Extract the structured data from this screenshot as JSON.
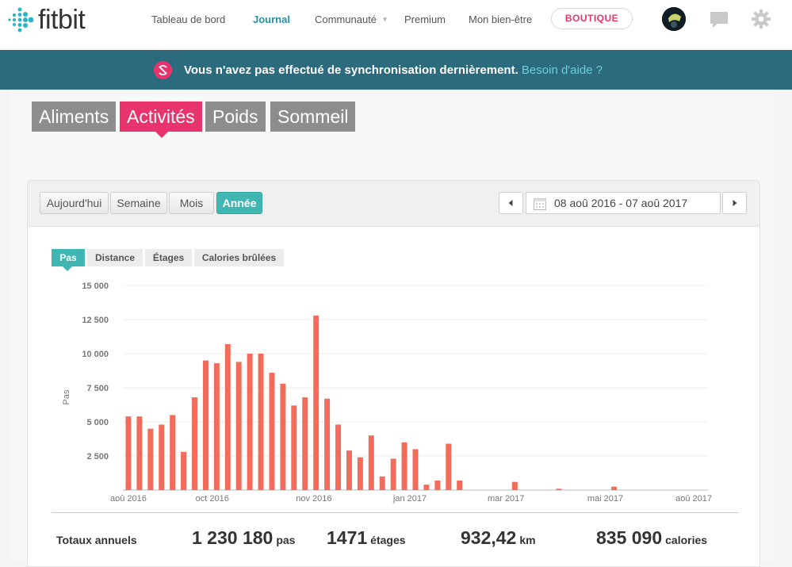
{
  "brand": {
    "name": "fitbit",
    "accent": "#e8336d",
    "teal": "#3fb6b2",
    "banner_bg": "#2b6b7d"
  },
  "nav": {
    "items": [
      {
        "label": "Tableau de bord"
      },
      {
        "label": "Journal"
      },
      {
        "label": "Communauté"
      },
      {
        "label": "Premium"
      },
      {
        "label": "Mon bien-être"
      }
    ],
    "boutique": "BOUTIQUE",
    "icons": [
      "avatar",
      "chat-icon",
      "gear-icon"
    ]
  },
  "banner": {
    "message": "Vous n'avez pas effectué de synchronisation dernièrement.",
    "help": "Besoin d'aide ?"
  },
  "category_tabs": [
    "Aliments",
    "Activités",
    "Poids",
    "Sommeil"
  ],
  "range": {
    "buttons": [
      "Aujourd'hui",
      "Semaine",
      "Mois",
      "Année"
    ],
    "active": "Année",
    "date_range": "08 aoû 2016 - 07 aoû 2017"
  },
  "metric_tabs": [
    "Pas",
    "Distance",
    "Étages",
    "Calories brûlées"
  ],
  "chart_data": {
    "type": "bar",
    "ylabel": "Pas",
    "ylim": [
      0,
      15000
    ],
    "yticks": [
      "2 500",
      "5 000",
      "7 500",
      "10 000",
      "12 500",
      "15 000"
    ],
    "ytick_values": [
      2500,
      5000,
      7500,
      10000,
      12500,
      15000
    ],
    "xtick_labels": [
      "aoû 2016",
      "oct 2016",
      "nov 2016",
      "jan 2017",
      "mar 2017",
      "mai 2017",
      "aoû 2017"
    ],
    "xtick_weeks": [
      0,
      7.6,
      16.8,
      25.5,
      34.2,
      43.2,
      52
    ],
    "bar_color": "#f26b5b",
    "weeks": 53,
    "values": [
      5400,
      5400,
      4500,
      4800,
      5500,
      2800,
      6800,
      9500,
      9300,
      10700,
      9400,
      10000,
      10000,
      8600,
      7800,
      6200,
      6800,
      12800,
      6700,
      4800,
      2900,
      2400,
      4000,
      1000,
      2300,
      3500,
      3000,
      400,
      700,
      3400,
      700,
      0,
      0,
      0,
      0,
      600,
      0,
      0,
      0,
      100,
      0,
      0,
      0,
      0,
      250,
      0,
      0,
      0,
      0,
      0,
      0,
      0,
      0
    ]
  },
  "totals": {
    "label": "Totaux annuels",
    "steps": {
      "value": "1 230 180",
      "unit": "pas"
    },
    "floors": {
      "value": "1471",
      "unit": "étages"
    },
    "distance": {
      "value": "932,42",
      "unit": "km"
    },
    "calories": {
      "value": "835 090",
      "unit": "calories"
    }
  }
}
